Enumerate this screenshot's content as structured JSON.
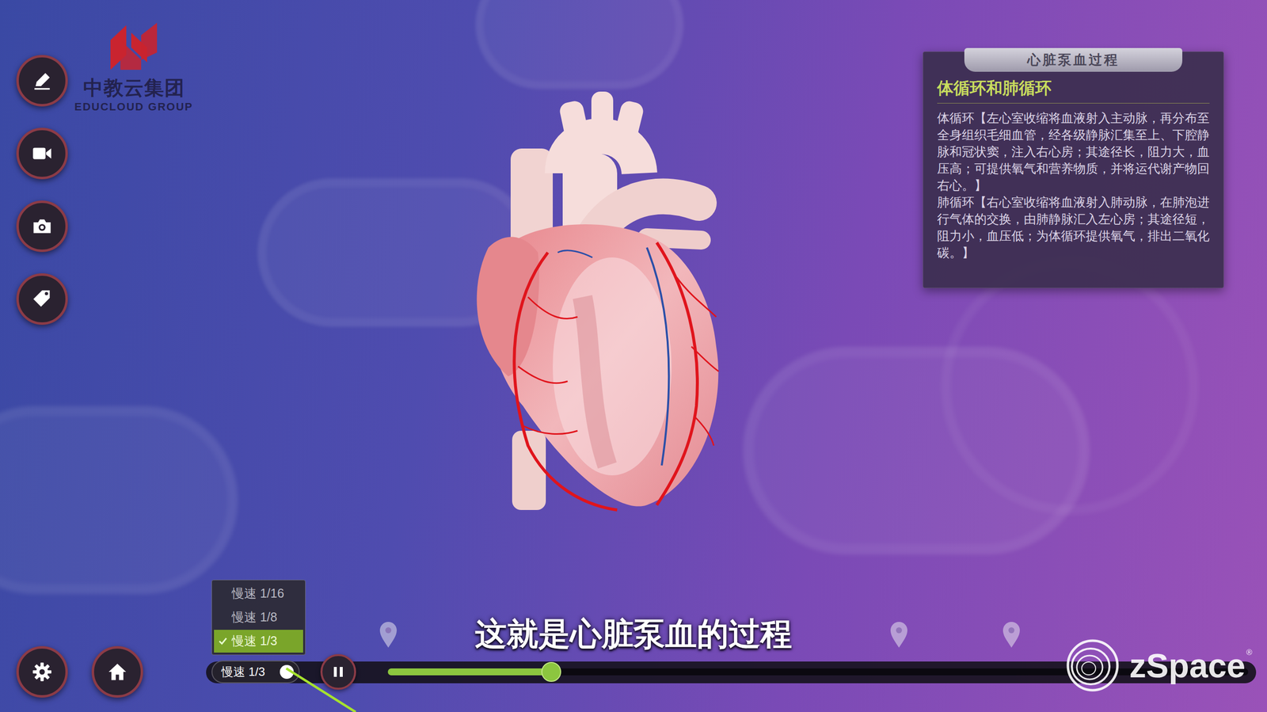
{
  "logo": {
    "name": "中教云集团",
    "subtitle": "EDUCLOUD GROUP"
  },
  "toolbar": [
    {
      "kind": "pen"
    },
    {
      "kind": "video"
    },
    {
      "kind": "camera"
    },
    {
      "kind": "tag"
    }
  ],
  "bottom_buttons": [
    {
      "kind": "settings"
    },
    {
      "kind": "home"
    }
  ],
  "info_panel": {
    "title": "心脏泵血过程",
    "heading": "体循环和肺循环",
    "paragraphs": [
      "体循环【左心室收缩将血液射入主动脉，再分布至全身组织毛细血管，经各级静脉汇集至上、下腔静脉和冠状窦，注入右心房；其途径长，阻力大，血压高；可提供氧气和营养物质，并将运代谢产物回右心。】",
      "肺循环【右心室收缩将血液射入肺动脉，在肺泡进行气体的交换，由肺静脉汇入左心房；其途径短，阻力小，血压低；为体循环提供氧气，排出二氧化碳。】"
    ]
  },
  "caption": "这就是心脏泵血的过程",
  "speed_menu": {
    "options": [
      {
        "label": "慢速 1/16",
        "selected": false
      },
      {
        "label": "慢速 1/8",
        "selected": false
      },
      {
        "label": "慢速 1/3",
        "selected": true
      }
    ],
    "current": "慢速 1/3"
  },
  "playback": {
    "playing": true,
    "level": 0.19
  },
  "brand": {
    "name": "zSpace",
    "mark": "®"
  }
}
